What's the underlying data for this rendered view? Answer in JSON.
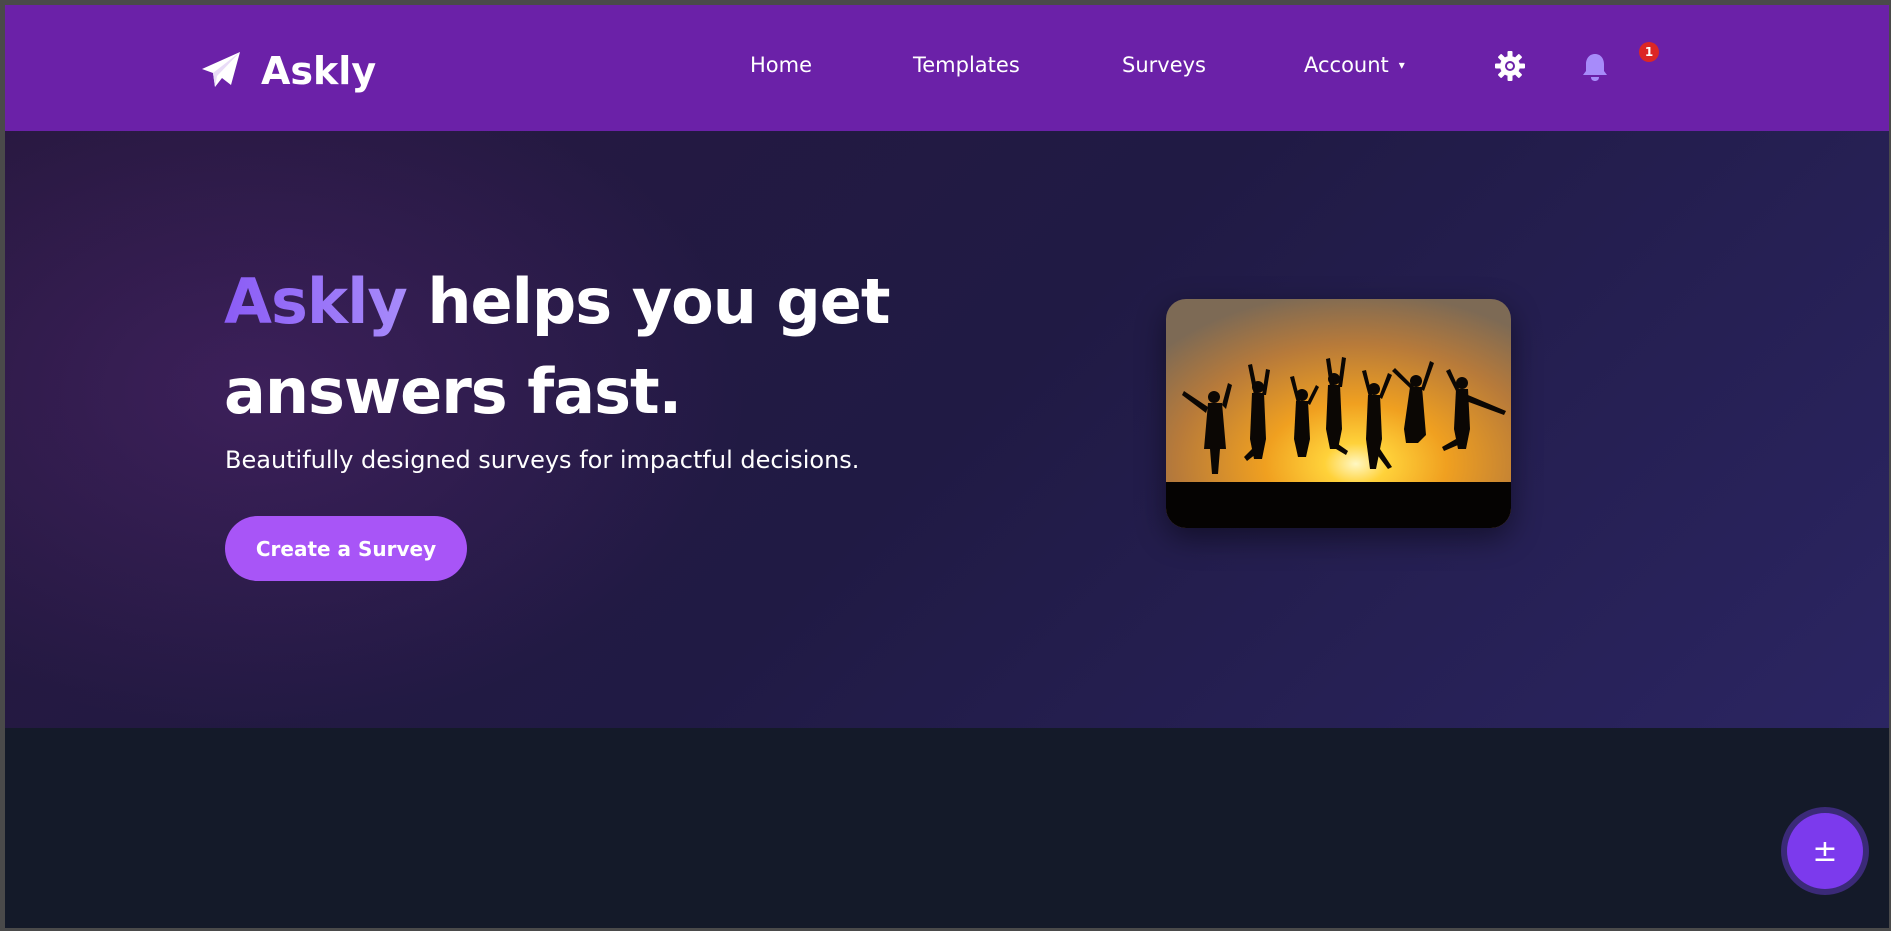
{
  "brand": {
    "name": "Askly",
    "icon": "paper-plane-icon"
  },
  "nav": {
    "home": "Home",
    "templates": "Templates",
    "surveys": "Surveys",
    "account": "Account",
    "account_caret": "▾",
    "settings_icon": "gear-icon",
    "notifications_icon": "bell-icon",
    "notification_count": "1"
  },
  "hero": {
    "headline_accent": "Askly",
    "headline_rest": " helps you get answers fast.",
    "subheadline": "Beautifully designed surveys for impactful decisions.",
    "cta_label": "Create a Survey",
    "image": "silhouettes-jumping-at-sunset"
  },
  "fab": {
    "label": "±",
    "icon": "plus-minus-icon"
  },
  "colors": {
    "navbar": "#6b21a8",
    "accent": "#8b5cf6",
    "cta": "#a855f7",
    "fab": "#7c3aed",
    "badge": "#dc2626",
    "page_bg": "#141a29"
  }
}
